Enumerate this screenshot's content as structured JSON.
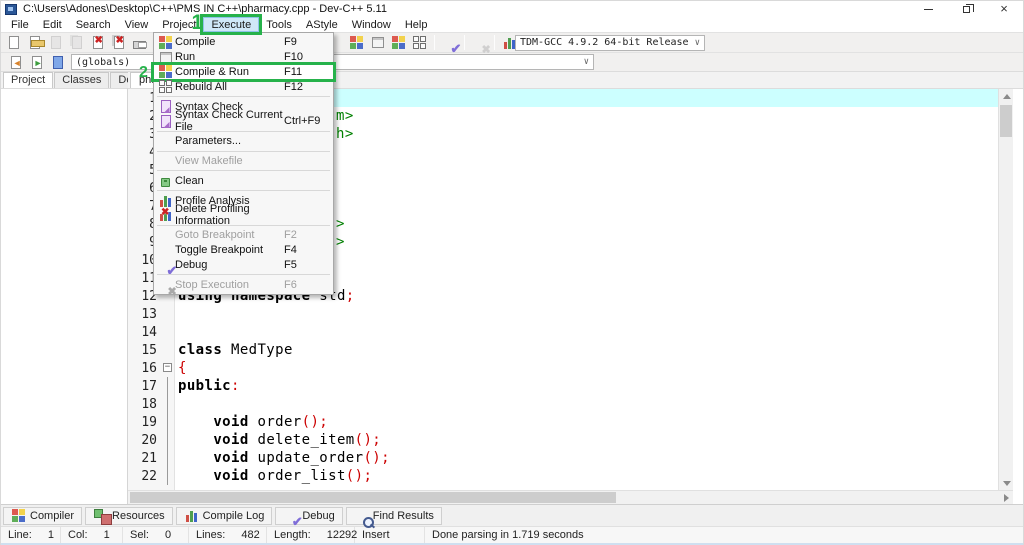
{
  "window": {
    "title": "C:\\Users\\Adones\\Desktop\\C++\\PMS IN C++\\pharmacy.cpp - Dev-C++ 5.11",
    "controls": [
      "minimize",
      "restore",
      "close"
    ]
  },
  "colors": {
    "annotation_green": "#26b24b",
    "current_line_bg": "#ccffff",
    "include_green": "#008000",
    "symbol_red": "#cc0000"
  },
  "annotation": {
    "step1": "1",
    "step2": "2"
  },
  "menu_bar": [
    "File",
    "Edit",
    "Search",
    "View",
    "Project",
    "Execute",
    "Tools",
    "AStyle",
    "Window",
    "Help"
  ],
  "menu_active": "Execute",
  "toolbar_main": [
    {
      "icon": "new-file-icon"
    },
    {
      "icon": "open-file-icon"
    },
    {
      "icon": "save-icon",
      "disabled": true
    },
    {
      "icon": "save-all-icon",
      "disabled": true
    },
    {
      "icon": "close-file-icon"
    },
    {
      "icon": "close-all-icon"
    },
    {
      "icon": "print-icon"
    },
    "|",
    {
      "icon": "back-icon",
      "disabled": true
    },
    {
      "icon": "forward-icon",
      "disabled": true
    }
  ],
  "toolbar_compile": [
    {
      "icon": "compile-icon"
    },
    {
      "icon": "run-icon"
    },
    {
      "icon": "compile-run-icon"
    },
    {
      "icon": "rebuild-all-icon"
    },
    "|",
    {
      "icon": "debug-check-icon"
    },
    "|",
    {
      "icon": "stop-execution-icon",
      "disabled": true
    },
    "|",
    {
      "icon": "profile-analysis-icon"
    },
    {
      "icon": "delete-profiling-icon"
    }
  ],
  "toolbar_specials": [
    {
      "icon": "insert-icon"
    },
    {
      "icon": "toggle-bookmark-icon"
    },
    {
      "icon": "goto-bookmark-icon"
    }
  ],
  "combos": {
    "compiler_profile": "TDM-GCC 4.9.2 64-bit Release",
    "class_browser": "(globals)",
    "member_browser": ""
  },
  "execute_menu": [
    {
      "label": "Compile",
      "shortcut": "F9",
      "icon": "compile-icon"
    },
    {
      "label": "Run",
      "shortcut": "F10",
      "icon": "run-icon"
    },
    {
      "label": "Compile & Run",
      "shortcut": "F11",
      "icon": "compile-run-icon",
      "annotated": true
    },
    {
      "label": "Rebuild All",
      "shortcut": "F12",
      "icon": "rebuild-all-icon",
      "sep": true
    },
    {
      "label": "Syntax Check",
      "icon": "syntax-check-icon"
    },
    {
      "label": "Syntax Check Current File",
      "shortcut": "Ctrl+F9",
      "icon": "syntax-check-icon",
      "sep": true
    },
    {
      "label": "Parameters...",
      "sep": true
    },
    {
      "label": "View Makefile",
      "disabled": true,
      "sep": true
    },
    {
      "label": "Clean",
      "icon": "clean-icon",
      "sep": true
    },
    {
      "label": "Profile Analysis",
      "icon": "profile-analysis-icon"
    },
    {
      "label": "Delete Profiling Information",
      "icon": "delete-profiling-icon",
      "sep": true
    },
    {
      "label": "Goto Breakpoint",
      "shortcut": "F2",
      "disabled": true
    },
    {
      "label": "Toggle Breakpoint",
      "shortcut": "F4"
    },
    {
      "label": "Debug",
      "shortcut": "F5",
      "icon": "debug-check-icon",
      "sep": true
    },
    {
      "label": "Stop Execution",
      "shortcut": "F6",
      "disabled": true,
      "icon": "stop-execution-icon"
    }
  ],
  "side_panel": {
    "tabs": [
      "Project",
      "Classes",
      "Debug"
    ],
    "active": "Project"
  },
  "editor": {
    "tab": "pharmacy.cpp",
    "lines": [
      {
        "n": 1,
        "segs": [],
        "current": true
      },
      {
        "n": 2,
        "segs": [
          {
            "t": "m>",
            "c": "inc"
          }
        ],
        "off": 158
      },
      {
        "n": 3,
        "segs": [
          {
            "t": "h>",
            "c": "inc"
          }
        ],
        "off": 158
      },
      {
        "n": 4,
        "segs": []
      },
      {
        "n": 5,
        "segs": []
      },
      {
        "n": 6,
        "segs": []
      },
      {
        "n": 7,
        "segs": []
      },
      {
        "n": 8,
        "segs": [
          {
            "t": ">",
            "c": "inc"
          }
        ],
        "off": 158
      },
      {
        "n": 9,
        "segs": [
          {
            "t": ">",
            "c": "inc"
          }
        ],
        "off": 158
      },
      {
        "n": 10,
        "segs": []
      },
      {
        "n": 11,
        "segs": []
      },
      {
        "n": 12,
        "segs": [
          {
            "t": "using",
            "c": "kw"
          },
          {
            "t": " ",
            "c": "pl"
          },
          {
            "t": "namespace",
            "c": "kw"
          },
          {
            "t": " std",
            "c": "pl"
          },
          {
            "t": ";",
            "c": "sym"
          }
        ]
      },
      {
        "n": 13,
        "segs": []
      },
      {
        "n": 14,
        "segs": []
      },
      {
        "n": 15,
        "segs": [
          {
            "t": "class",
            "c": "kw"
          },
          {
            "t": " MedType",
            "c": "pl"
          }
        ]
      },
      {
        "n": 16,
        "segs": [
          {
            "t": "{",
            "c": "sym"
          }
        ],
        "fold": "box"
      },
      {
        "n": 17,
        "segs": [
          {
            "t": "public",
            "c": "kw"
          },
          {
            "t": ":",
            "c": "sym"
          }
        ],
        "fold": "line"
      },
      {
        "n": 18,
        "segs": [],
        "fold": "line"
      },
      {
        "n": 19,
        "segs": [
          {
            "t": "    ",
            "c": "pl"
          },
          {
            "t": "void",
            "c": "kw"
          },
          {
            "t": " order",
            "c": "pl"
          },
          {
            "t": "();",
            "c": "sym"
          }
        ],
        "fold": "line"
      },
      {
        "n": 20,
        "segs": [
          {
            "t": "    ",
            "c": "pl"
          },
          {
            "t": "void",
            "c": "kw"
          },
          {
            "t": " delete_item",
            "c": "pl"
          },
          {
            "t": "();",
            "c": "sym"
          }
        ],
        "fold": "line"
      },
      {
        "n": 21,
        "segs": [
          {
            "t": "    ",
            "c": "pl"
          },
          {
            "t": "void",
            "c": "kw"
          },
          {
            "t": " update_order",
            "c": "pl"
          },
          {
            "t": "();",
            "c": "sym"
          }
        ],
        "fold": "line"
      },
      {
        "n": 22,
        "segs": [
          {
            "t": "    ",
            "c": "pl"
          },
          {
            "t": "void",
            "c": "kw"
          },
          {
            "t": " order_list",
            "c": "pl"
          },
          {
            "t": "();",
            "c": "sym"
          }
        ],
        "fold": "line"
      }
    ]
  },
  "bottom_tabs": [
    {
      "label": "Compiler",
      "icon": "compiler-tab-icon"
    },
    {
      "label": "Resources",
      "icon": "resources-tab-icon"
    },
    {
      "label": "Compile Log",
      "icon": "compile-log-tab-icon"
    },
    {
      "label": "Debug",
      "icon": "debug-tab-icon"
    },
    {
      "label": "Find Results",
      "icon": "find-results-tab-icon"
    }
  ],
  "status_bar": [
    {
      "label": "Line:",
      "value": "1"
    },
    {
      "label": "Col:",
      "value": "1"
    },
    {
      "label": "Sel:",
      "value": "0"
    },
    {
      "label": "Lines:",
      "value": "482"
    },
    {
      "label": "Length:",
      "value": "12292"
    },
    {
      "label": "Insert",
      "value": ""
    },
    {
      "label": "Done parsing in 1.719 seconds",
      "value": ""
    }
  ]
}
